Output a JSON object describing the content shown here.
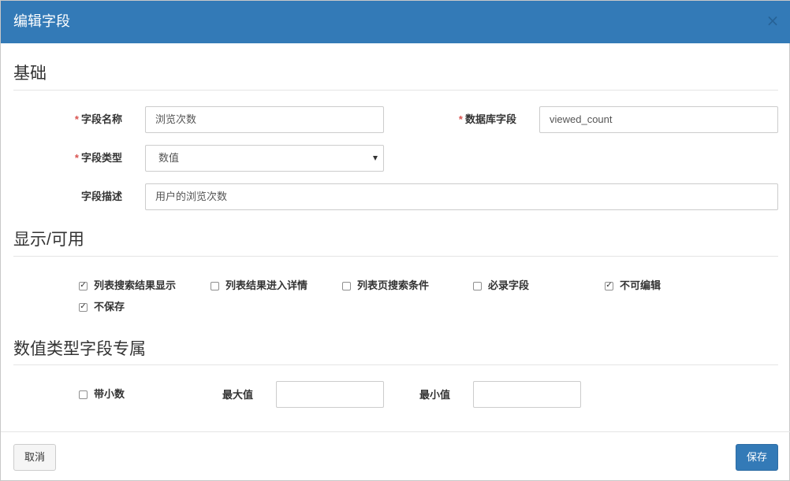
{
  "modal": {
    "title": "编辑字段",
    "close_symbol": "×"
  },
  "sections": {
    "basic": {
      "title": "基础"
    },
    "display": {
      "title": "显示/可用"
    },
    "numeric": {
      "title": "数值类型字段专属"
    }
  },
  "fields": {
    "required_marker": "*",
    "field_name": {
      "label": "字段名称",
      "value": "浏览次数",
      "required": true
    },
    "db_field": {
      "label": "数据库字段",
      "value": "viewed_count",
      "required": true
    },
    "field_type": {
      "label": "字段类型",
      "selected": "数值",
      "required": true
    },
    "field_desc": {
      "label": "字段描述",
      "value": "用户的浏览次数",
      "required": false
    }
  },
  "display_options": [
    {
      "label": "列表搜索结果显示",
      "checked": true
    },
    {
      "label": "列表结果进入详情",
      "checked": false
    },
    {
      "label": "列表页搜索条件",
      "checked": false
    },
    {
      "label": "必录字段",
      "checked": false
    },
    {
      "label": "不可编辑",
      "checked": true
    },
    {
      "label": "不保存",
      "checked": true
    }
  ],
  "numeric": {
    "decimal": {
      "label": "带小数",
      "checked": false
    },
    "max": {
      "label": "最大值",
      "value": ""
    },
    "min": {
      "label": "最小值",
      "value": ""
    }
  },
  "footer": {
    "cancel_label": "取消",
    "save_label": "保存"
  },
  "colors": {
    "header_bg": "#337ab7",
    "primary": "#337ab7",
    "required": "#d9534f"
  }
}
